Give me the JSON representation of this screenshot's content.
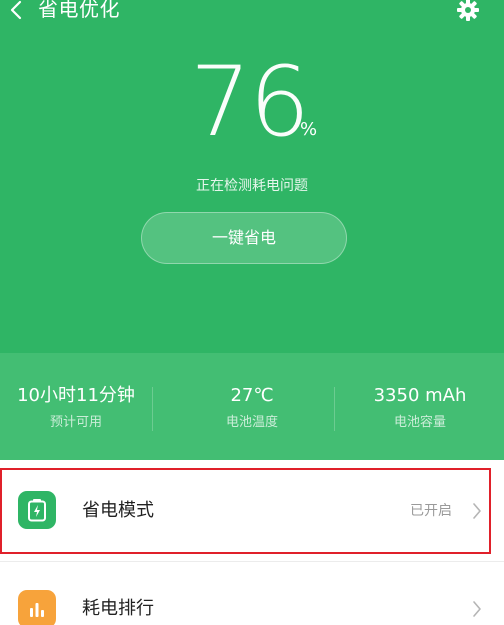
{
  "header": {
    "title": "省电优化",
    "back_icon": "chevron-left-icon",
    "settings_icon": "gear-icon"
  },
  "battery": {
    "percent": "76",
    "percent_sign": "%",
    "status": "正在检测耗电问题",
    "optimize_label": "一键省电"
  },
  "stats": [
    {
      "value": "10小时11分钟",
      "label": "预计可用"
    },
    {
      "value": "27℃",
      "label": "电池温度"
    },
    {
      "value": "3350 mAh",
      "label": "电池容量"
    }
  ],
  "list": {
    "items": [
      {
        "label": "省电模式",
        "value": "已开启",
        "icon": "battery-charging-icon",
        "icon_color": "#2fb565"
      },
      {
        "label": "耗电排行",
        "value": "",
        "icon": "bar-chart-icon",
        "icon_color": "#f7a33b"
      }
    ]
  },
  "colors": {
    "primary_green": "#2fb565",
    "stats_green": "#43be73",
    "highlight_red": "#e0202a"
  }
}
